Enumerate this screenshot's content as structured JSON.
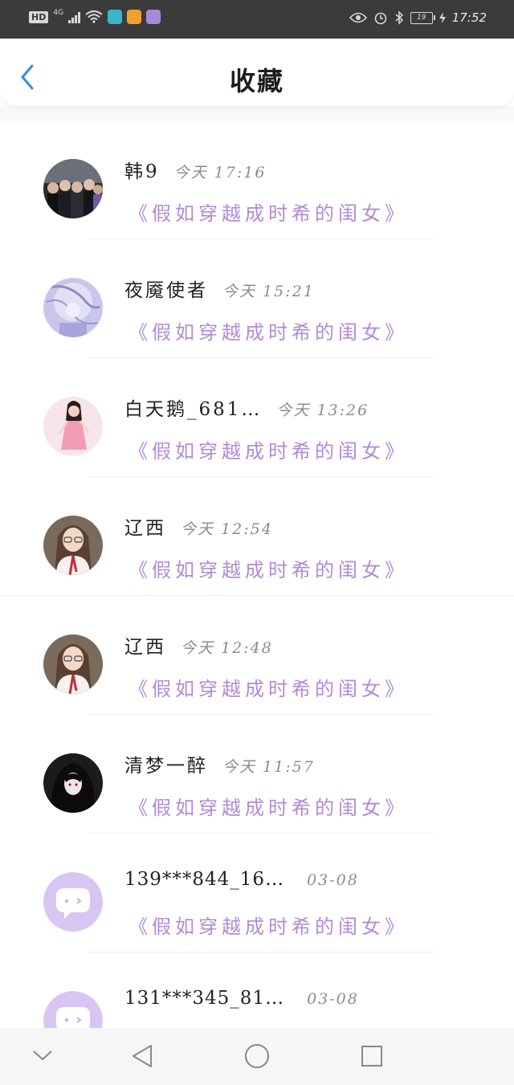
{
  "status_bar": {
    "hd": "HD",
    "network": "4G",
    "battery": "19",
    "time": "17:52"
  },
  "header": {
    "title": "收藏"
  },
  "items": [
    {
      "name": "韩9",
      "time": "今天 17:16",
      "book": "《假如穿越成时希的闺女》",
      "avatar": "group-photo"
    },
    {
      "name": "夜魇使者",
      "time": "今天 15:21",
      "book": "《假如穿越成时希的闺女》",
      "avatar": "anime-lavender"
    },
    {
      "name": "白天鹅_681…",
      "time": "今天 13:26",
      "book": "《假如穿越成时希的闺女》",
      "avatar": "pink-dress"
    },
    {
      "name": "辽西",
      "time": "今天 12:54",
      "book": "《假如穿越成时希的闺女》",
      "avatar": "glasses-girl"
    },
    {
      "name": "辽西",
      "time": "今天 12:48",
      "book": "《假如穿越成时希的闺女》",
      "avatar": "glasses-girl"
    },
    {
      "name": "清梦一醉",
      "time": "今天 11:57",
      "book": "《假如穿越成时希的闺女》",
      "avatar": "dark-anime"
    },
    {
      "name": "139***844_16…",
      "time": "03-08",
      "book": "《假如穿越成时希的闺女》",
      "avatar": "default-chat"
    },
    {
      "name": "131***345_81…",
      "time": "03-08",
      "book": "",
      "avatar": "default-chat"
    }
  ],
  "colors": {
    "accent": "#2f8ee8",
    "book_title": "#b28ad6",
    "default_avatar": "#d8c5f1"
  }
}
